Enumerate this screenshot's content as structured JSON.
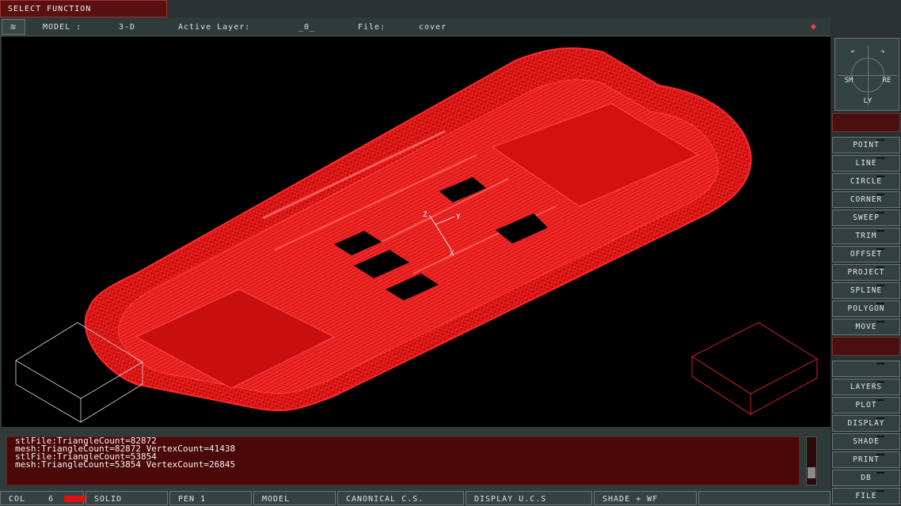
{
  "header": {
    "function_label": "SELECT FUNCTION",
    "model_label": "MODEL :",
    "model_value": "3-D",
    "layer_label": "Active Layer:",
    "layer_value": "_0_",
    "file_label": "File:",
    "file_value": "cover"
  },
  "console": {
    "lines": [
      "stlFile:TriangleCount=82872",
      "mesh:TriangleCount=82872 VertexCount=41438",
      "stlFile:TriangleCount=53854",
      "mesh:TriangleCount=53854 VertexCount=26845"
    ]
  },
  "status": {
    "col_label": "COL",
    "col_value": "6",
    "col_color": "#e01010",
    "solid": "SOLID",
    "pen": "PEN 1",
    "model": "MODEL",
    "canonical": "CANONICAL C.S.",
    "display_ucs": "DISPLAY U.C.S",
    "shade_wf": "SHADE + WF"
  },
  "navpad": {
    "sm": "SM",
    "re": "RE",
    "ly": "LY"
  },
  "menu": {
    "group1": [
      "POINT",
      "LINE",
      "CIRCLE",
      "CORNER",
      "SWEEP",
      "TRIM",
      "OFFSET",
      "PROJECT",
      "SPLINE",
      "POLYGON",
      "MOVE"
    ],
    "group2": [
      "",
      "LAYERS",
      "PLOT",
      "DISPLAY",
      "SHADE",
      "PRINT",
      "DB",
      "FILE"
    ]
  },
  "axes": {
    "x": "X",
    "y": "Y",
    "z": "Z"
  },
  "colors": {
    "mesh": "#ff1a1a",
    "accent_red": "#5a1010",
    "panel": "#2f3a3a"
  }
}
